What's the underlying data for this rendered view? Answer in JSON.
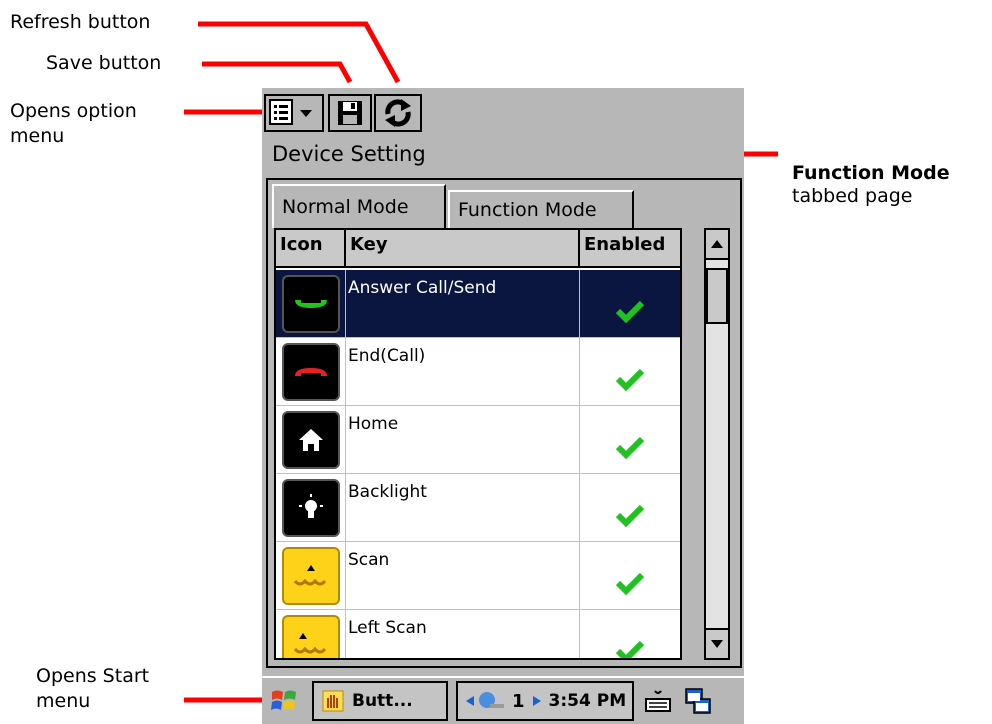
{
  "callouts": {
    "refresh": "Refresh button",
    "save": "Save button",
    "options_line1": "Opens option",
    "options_line2": "menu",
    "function_mode_title": "Function Mode",
    "function_mode_sub": "tabbed page",
    "start_line1": "Opens Start",
    "start_line2": "menu"
  },
  "app": {
    "title": "Device Setting",
    "tabs": [
      {
        "label": "Normal Mode",
        "active": true
      },
      {
        "label": "Function Mode",
        "active": false
      }
    ],
    "columns": [
      "Icon",
      "Key",
      "Enabled"
    ],
    "rows": [
      {
        "key": "Answer Call/Send",
        "icon": "answer-call-icon",
        "enabled": true,
        "selected": true
      },
      {
        "key": "End(Call)",
        "icon": "end-call-icon",
        "enabled": true,
        "selected": false
      },
      {
        "key": "Home",
        "icon": "home-icon",
        "enabled": true,
        "selected": false
      },
      {
        "key": "Backlight",
        "icon": "backlight-icon",
        "enabled": true,
        "selected": false
      },
      {
        "key": "Scan",
        "icon": "scan-icon",
        "enabled": true,
        "selected": false
      },
      {
        "key": "Left Scan",
        "icon": "left-scan-icon",
        "enabled": true,
        "selected": false
      }
    ]
  },
  "taskbar": {
    "app_button": "Butt...",
    "page_number": "1",
    "time": "3:54 PM"
  },
  "colors": {
    "callout_line": "#ff0000",
    "selected_row": "#0a1540",
    "check": "#22c122",
    "screen_bg": "#b7b7b7"
  }
}
